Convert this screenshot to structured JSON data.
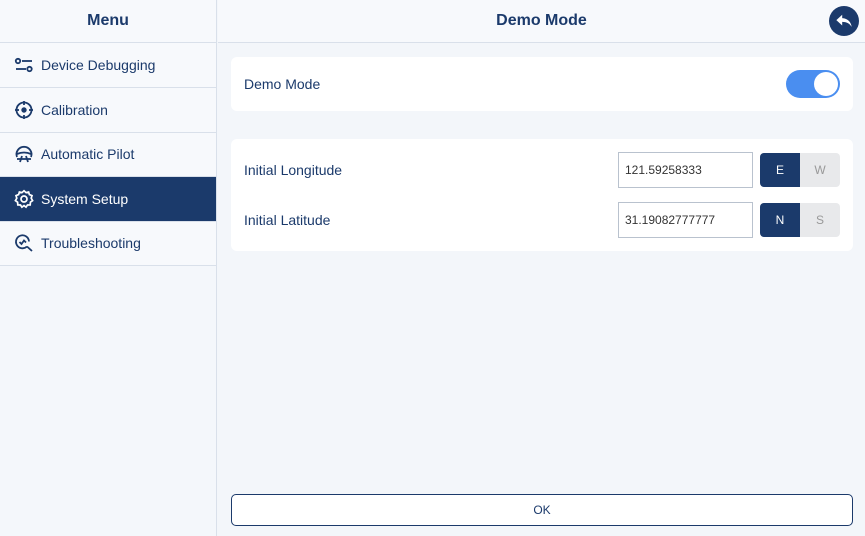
{
  "sidebar": {
    "title": "Menu",
    "items": [
      {
        "label": "Device Debugging",
        "icon": "sliders-icon"
      },
      {
        "label": "Calibration",
        "icon": "crosshair-icon"
      },
      {
        "label": "Automatic Pilot",
        "icon": "steering-wheel-icon"
      },
      {
        "label": "System Setup",
        "icon": "gear-icon",
        "active": true
      },
      {
        "label": "Troubleshooting",
        "icon": "search-refresh-icon"
      }
    ]
  },
  "header": {
    "title": "Demo Mode",
    "back_icon": "back-arrow-icon"
  },
  "demo_mode": {
    "label": "Demo Mode",
    "enabled": true
  },
  "coordinates": {
    "longitude": {
      "label": "Initial Longitude",
      "value": "121.59258333",
      "options": [
        "E",
        "W"
      ],
      "selected": "E"
    },
    "latitude": {
      "label": "Initial Latitude",
      "value": "31.19082777777",
      "options": [
        "N",
        "S"
      ],
      "selected": "N"
    }
  },
  "ok_label": "OK",
  "colors": {
    "primary": "#1b3a6b",
    "toggle_on": "#4a8ef0",
    "background": "#f3f6fa"
  }
}
